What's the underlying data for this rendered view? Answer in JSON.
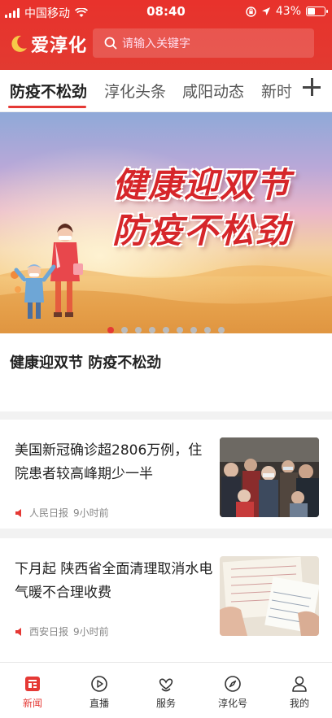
{
  "status_bar": {
    "carrier": "中国移动",
    "time": "08:40",
    "battery": "43%"
  },
  "app": {
    "logo_text": "爱淳化",
    "search_placeholder": "请输入关键字"
  },
  "tabs": [
    {
      "label": "防疫不松劲",
      "active": true
    },
    {
      "label": "淳化头条",
      "active": false
    },
    {
      "label": "咸阳动态",
      "active": false
    },
    {
      "label": "新时",
      "active": false
    }
  ],
  "banner": {
    "title_line1": "健康迎双节",
    "title_line2": "防疫不松劲",
    "caption": "健康迎双节 防疫不松劲",
    "slide_count": 9,
    "active_slide": 1
  },
  "news": [
    {
      "title": "美国新冠确诊超2806万例，住院患者较高峰期少一半",
      "source": "人民日报",
      "time": "9小时前"
    },
    {
      "title": "下月起 陕西省全面清理取消水电气暖不合理收费",
      "source": "西安日报",
      "time": "9小时前"
    }
  ],
  "bottom_nav": [
    {
      "label": "新闻",
      "icon": "news-icon",
      "active": true
    },
    {
      "label": "直播",
      "icon": "play-icon",
      "active": false
    },
    {
      "label": "服务",
      "icon": "service-icon",
      "active": false
    },
    {
      "label": "淳化号",
      "icon": "compass-icon",
      "active": false
    },
    {
      "label": "我的",
      "icon": "user-icon",
      "active": false
    }
  ],
  "colors": {
    "brand_red": "#e53935",
    "header_red": "#e8322c"
  }
}
